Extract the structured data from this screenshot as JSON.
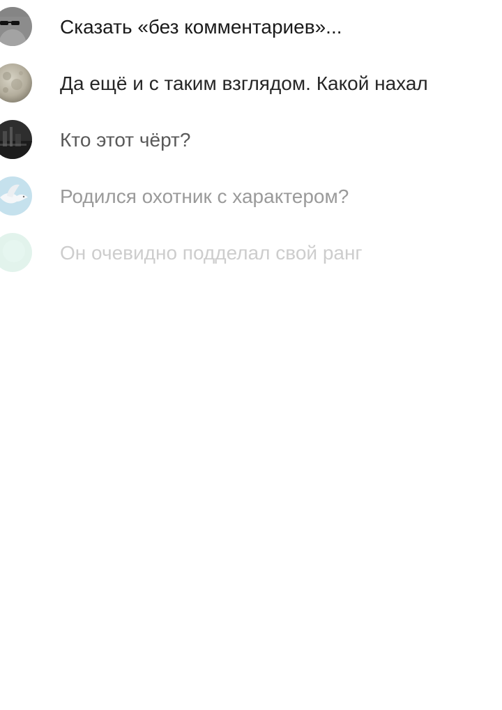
{
  "comments": [
    {
      "avatar_icon": "sunglasses-avatar-icon",
      "text": "Сказать «без комментариев»..."
    },
    {
      "avatar_icon": "moon-avatar-icon",
      "text": "Да ещё и с таким взглядом. Какой нахал"
    },
    {
      "avatar_icon": "dark-photo-avatar-icon",
      "text": "Кто этот чёрт?"
    },
    {
      "avatar_icon": "dove-avatar-icon",
      "text": "Родился охотник с характером?"
    },
    {
      "avatar_icon": "mint-avatar-icon",
      "text": "Он очевидно подделал свой ранг"
    }
  ],
  "colors": {
    "background": "#ffffff",
    "text_primary": "#1a1a1a",
    "text_faded": "#cdcdcd"
  }
}
